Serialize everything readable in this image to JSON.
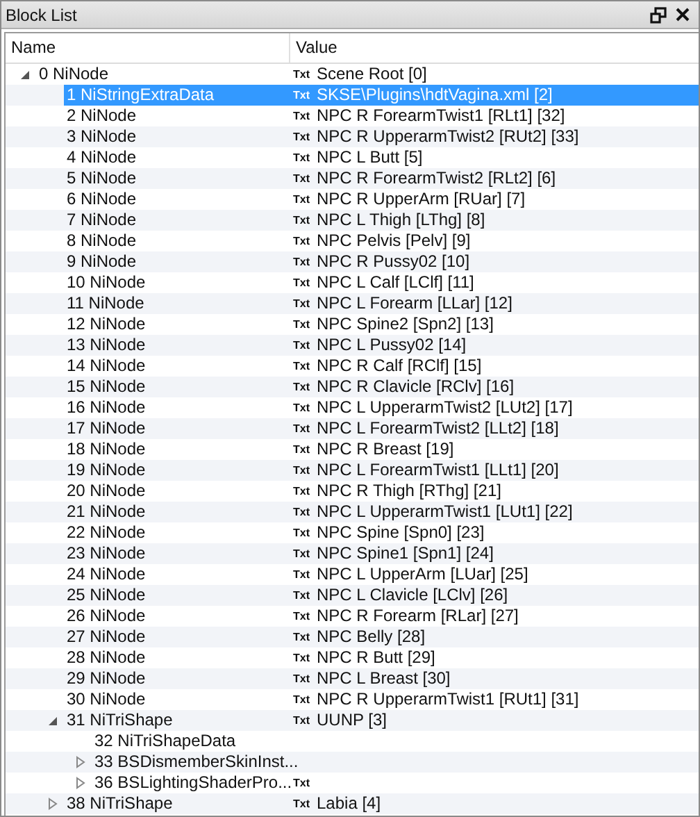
{
  "panel": {
    "title": "Block List"
  },
  "columns": [
    "Name",
    "Value"
  ],
  "tree": [
    {
      "name": "0 NiNode",
      "tag": "Txt",
      "value": "Scene Root [0]",
      "selected": false,
      "expanded": true,
      "children": [
        {
          "name": "1 NiStringExtraData",
          "tag": "Txt",
          "value": "SKSE\\Plugins\\hdtVagina.xml [2]",
          "selected": true
        },
        {
          "name": "2 NiNode",
          "tag": "Txt",
          "value": "NPC R ForearmTwist1 [RLt1] [32]",
          "selected": false
        },
        {
          "name": "3 NiNode",
          "tag": "Txt",
          "value": "NPC R UpperarmTwist2 [RUt2] [33]",
          "selected": false
        },
        {
          "name": "4 NiNode",
          "tag": "Txt",
          "value": "NPC L Butt [5]",
          "selected": false
        },
        {
          "name": "5 NiNode",
          "tag": "Txt",
          "value": "NPC R ForearmTwist2 [RLt2] [6]",
          "selected": false
        },
        {
          "name": "6 NiNode",
          "tag": "Txt",
          "value": "NPC R UpperArm [RUar] [7]",
          "selected": false
        },
        {
          "name": "7 NiNode",
          "tag": "Txt",
          "value": "NPC L Thigh [LThg] [8]",
          "selected": false
        },
        {
          "name": "8 NiNode",
          "tag": "Txt",
          "value": "NPC Pelvis [Pelv] [9]",
          "selected": false
        },
        {
          "name": "9 NiNode",
          "tag": "Txt",
          "value": "NPC R Pussy02 [10]",
          "selected": false
        },
        {
          "name": "10 NiNode",
          "tag": "Txt",
          "value": "NPC L Calf [LClf] [11]",
          "selected": false
        },
        {
          "name": "11 NiNode",
          "tag": "Txt",
          "value": "NPC L Forearm [LLar] [12]",
          "selected": false
        },
        {
          "name": "12 NiNode",
          "tag": "Txt",
          "value": "NPC Spine2 [Spn2] [13]",
          "selected": false
        },
        {
          "name": "13 NiNode",
          "tag": "Txt",
          "value": "NPC L Pussy02 [14]",
          "selected": false
        },
        {
          "name": "14 NiNode",
          "tag": "Txt",
          "value": "NPC R Calf [RClf] [15]",
          "selected": false
        },
        {
          "name": "15 NiNode",
          "tag": "Txt",
          "value": "NPC R Clavicle [RClv] [16]",
          "selected": false
        },
        {
          "name": "16 NiNode",
          "tag": "Txt",
          "value": "NPC L UpperarmTwist2 [LUt2] [17]",
          "selected": false
        },
        {
          "name": "17 NiNode",
          "tag": "Txt",
          "value": "NPC L ForearmTwist2 [LLt2] [18]",
          "selected": false
        },
        {
          "name": "18 NiNode",
          "tag": "Txt",
          "value": "NPC R Breast [19]",
          "selected": false
        },
        {
          "name": "19 NiNode",
          "tag": "Txt",
          "value": "NPC L ForearmTwist1 [LLt1] [20]",
          "selected": false
        },
        {
          "name": "20 NiNode",
          "tag": "Txt",
          "value": "NPC R Thigh [RThg] [21]",
          "selected": false
        },
        {
          "name": "21 NiNode",
          "tag": "Txt",
          "value": "NPC L UpperarmTwist1 [LUt1] [22]",
          "selected": false
        },
        {
          "name": "22 NiNode",
          "tag": "Txt",
          "value": "NPC Spine [Spn0] [23]",
          "selected": false
        },
        {
          "name": "23 NiNode",
          "tag": "Txt",
          "value": "NPC Spine1 [Spn1] [24]",
          "selected": false
        },
        {
          "name": "24 NiNode",
          "tag": "Txt",
          "value": "NPC L UpperArm [LUar] [25]",
          "selected": false
        },
        {
          "name": "25 NiNode",
          "tag": "Txt",
          "value": "NPC L Clavicle [LClv] [26]",
          "selected": false
        },
        {
          "name": "26 NiNode",
          "tag": "Txt",
          "value": "NPC R Forearm [RLar] [27]",
          "selected": false
        },
        {
          "name": "27 NiNode",
          "tag": "Txt",
          "value": "NPC Belly [28]",
          "selected": false
        },
        {
          "name": "28 NiNode",
          "tag": "Txt",
          "value": "NPC R Butt [29]",
          "selected": false
        },
        {
          "name": "29 NiNode",
          "tag": "Txt",
          "value": "NPC L Breast [30]",
          "selected": false
        },
        {
          "name": "30 NiNode",
          "tag": "Txt",
          "value": "NPC R UpperarmTwist1 [RUt1] [31]",
          "selected": false
        },
        {
          "name": "31 NiTriShape",
          "tag": "Txt",
          "value": "UUNP [3]",
          "selected": false,
          "expanded": true,
          "children": [
            {
              "name": "32 NiTriShapeData",
              "selected": false
            },
            {
              "name": "33 BSDismemberSkinInst...",
              "selected": false,
              "expanded": false
            },
            {
              "name": "36 BSLightingShaderPro...",
              "tag": "Txt",
              "selected": false,
              "expanded": false
            }
          ]
        },
        {
          "name": "38 NiTriShape",
          "tag": "Txt",
          "value": "Labia [4]",
          "selected": false,
          "expanded": false
        }
      ]
    }
  ]
}
